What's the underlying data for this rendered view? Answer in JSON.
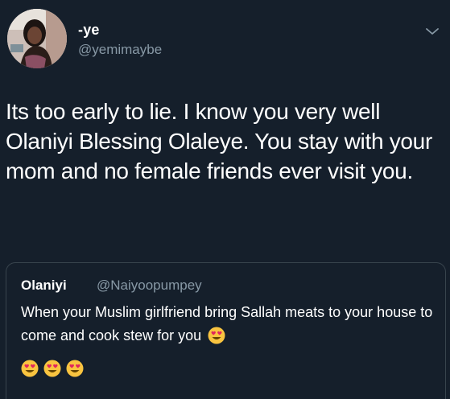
{
  "tweet": {
    "display_name": "-ye",
    "handle": "@yemimaybe",
    "text": "Its too early to lie. I know you very well Olaniyi Blessing Olaleye. You stay with your mom and no female friends ever visit you."
  },
  "quoted_tweet": {
    "display_name": "Olaniyi",
    "handle": "@Naiyoopumpey",
    "text": "When your Muslim girlfriend bring Sallah meats to your house to come and cook stew for you",
    "emoji_name": "heart-eyes-emoji",
    "trailing_emoji_count": 3
  },
  "icons": {
    "menu": "chevron-down-icon"
  },
  "colors": {
    "background": "#151f2b",
    "secondary_text": "#8899a6",
    "border": "#38444d",
    "emoji_face": "#f9c440",
    "emoji_heart": "#e0245e"
  }
}
